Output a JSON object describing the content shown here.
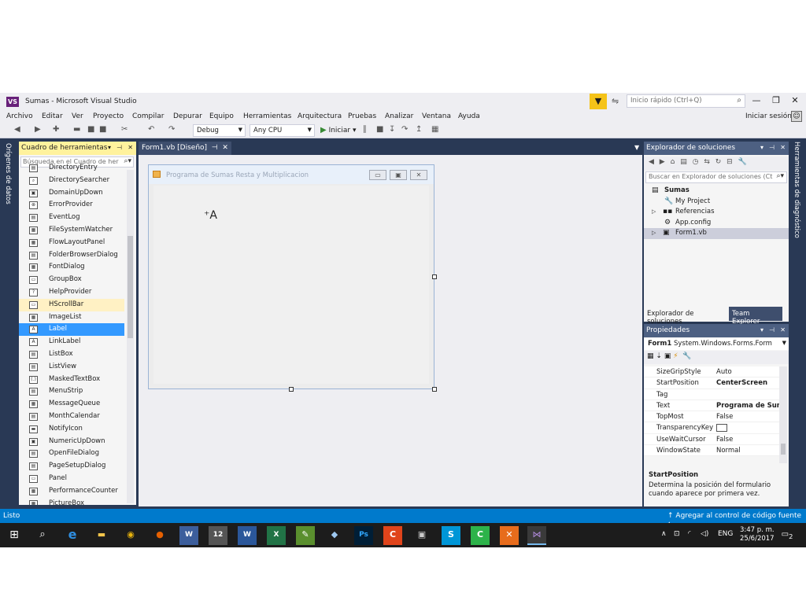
{
  "window": {
    "title": "Sumas - Microsoft Visual Studio",
    "logo": "VS"
  },
  "quick_launch": {
    "placeholder": "Inicio rápido (Ctrl+Q)"
  },
  "menu": [
    "Archivo",
    "Editar",
    "Ver",
    "Proyecto",
    "Compilar",
    "Depurar",
    "Equipo",
    "Herramientas",
    "Arquitectura",
    "Pruebas",
    "Analizar",
    "Ventana",
    "Ayuda"
  ],
  "signin": "Iniciar sesión",
  "toolbar": {
    "config": "Debug",
    "platform": "Any CPU",
    "start": "Iniciar"
  },
  "side_tabs": {
    "left": "Orígenes de datos",
    "right": "Herramientas de diagnóstico"
  },
  "toolbox": {
    "title": "Cuadro de herramientas",
    "search_placeholder": "Búsqueda en el Cuadro de her",
    "items": [
      {
        "label": "DirectoryEntry",
        "state": ""
      },
      {
        "label": "DirectorySearcher",
        "state": ""
      },
      {
        "label": "DomainUpDown",
        "state": ""
      },
      {
        "label": "ErrorProvider",
        "state": ""
      },
      {
        "label": "EventLog",
        "state": ""
      },
      {
        "label": "FileSystemWatcher",
        "state": ""
      },
      {
        "label": "FlowLayoutPanel",
        "state": ""
      },
      {
        "label": "FolderBrowserDialog",
        "state": ""
      },
      {
        "label": "FontDialog",
        "state": ""
      },
      {
        "label": "GroupBox",
        "state": ""
      },
      {
        "label": "HelpProvider",
        "state": ""
      },
      {
        "label": "HScrollBar",
        "state": "highlight"
      },
      {
        "label": "ImageList",
        "state": ""
      },
      {
        "label": "Label",
        "state": "selected"
      },
      {
        "label": "LinkLabel",
        "state": ""
      },
      {
        "label": "ListBox",
        "state": ""
      },
      {
        "label": "ListView",
        "state": ""
      },
      {
        "label": "MaskedTextBox",
        "state": ""
      },
      {
        "label": "MenuStrip",
        "state": ""
      },
      {
        "label": "MessageQueue",
        "state": ""
      },
      {
        "label": "MonthCalendar",
        "state": ""
      },
      {
        "label": "NotifyIcon",
        "state": ""
      },
      {
        "label": "NumericUpDown",
        "state": ""
      },
      {
        "label": "OpenFileDialog",
        "state": ""
      },
      {
        "label": "PageSetupDialog",
        "state": ""
      },
      {
        "label": "Panel",
        "state": ""
      },
      {
        "label": "PerformanceCounter",
        "state": ""
      },
      {
        "label": "PictureBox",
        "state": ""
      }
    ]
  },
  "document": {
    "tab": "Form1.vb [Diseño]",
    "form_title": "Programa de Sumas Resta y Multiplicacion"
  },
  "solution_explorer": {
    "title": "Explorador de soluciones",
    "search_placeholder": "Buscar en Explorador de soluciones (Ct",
    "nodes": [
      "Sumas",
      "My Project",
      "Referencias",
      "App.config",
      "Form1.vb"
    ],
    "tabs": [
      "Explorador de soluciones",
      "Team Explorer"
    ]
  },
  "properties": {
    "title": "Propiedades",
    "object_name": "Form1",
    "object_type": "System.Windows.Forms.Form",
    "rows": [
      {
        "name": "SizeGripStyle",
        "value": "Auto",
        "bold": false
      },
      {
        "name": "StartPosition",
        "value": "CenterScreen",
        "bold": true
      },
      {
        "name": "Tag",
        "value": "",
        "bold": false
      },
      {
        "name": "Text",
        "value": "Programa de Suma",
        "bold": true
      },
      {
        "name": "TopMost",
        "value": "False",
        "bold": false
      },
      {
        "name": "TransparencyKey",
        "value": "",
        "bold": false
      },
      {
        "name": "UseWaitCursor",
        "value": "False",
        "bold": false
      },
      {
        "name": "WindowState",
        "value": "Normal",
        "bold": false
      }
    ],
    "desc_title": "StartPosition",
    "desc_text": "Determina la posición del formulario cuando aparece por primera vez."
  },
  "status": {
    "left": "Listo",
    "right": "Agregar al control de código fuente"
  },
  "taskbar": {
    "lang": "ENG",
    "time": "3:47 p. m.",
    "date": "25/6/2017",
    "notifications": "2",
    "calendar_day": "12"
  }
}
